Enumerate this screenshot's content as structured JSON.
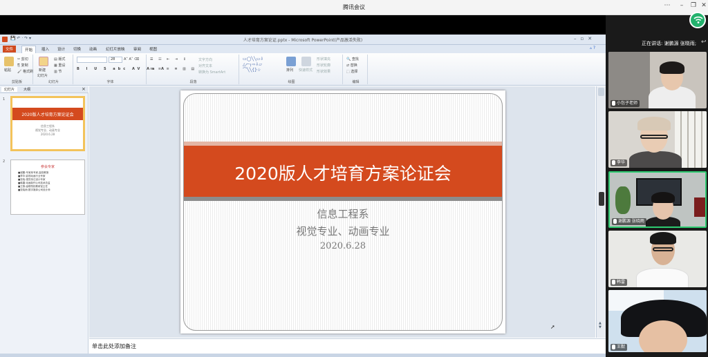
{
  "meeting": {
    "title": "腾讯会议",
    "speaking_label": "正在讲话: 谢鹏源 张晓雨;"
  },
  "ppt": {
    "window_title": "人才培育方案论证.pptx - Microsoft PowerPoint(产品激活失败)",
    "tabs": [
      "文件",
      "开始",
      "插入",
      "设计",
      "切换",
      "动画",
      "幻灯片放映",
      "审阅",
      "视图"
    ],
    "groups": {
      "clipboard": "剪贴板",
      "slides": "幻灯片",
      "font": "字体",
      "paragraph": "段落",
      "drawing": "绘图",
      "editing": "编辑"
    },
    "clipboard": {
      "paste": "粘贴",
      "cut": "剪切",
      "copy": "复制",
      "format": "格式刷"
    },
    "slides_group": {
      "new": "新建",
      "newslide": "幻灯片",
      "layout": "版式",
      "reset": "重设",
      "section": "节"
    },
    "font": {
      "size": "28"
    },
    "paragraph": {
      "direction": "文字方向",
      "align": "对齐文本",
      "smartart": "转换为 SmartArt"
    },
    "drawing": {
      "arrange": "排列",
      "quickstyles": "快速样式",
      "fill": "形状填充",
      "outline": "形状轮廓",
      "effects": "形状效果"
    },
    "editing": {
      "find": "查找",
      "replace": "替换",
      "select": "选择"
    },
    "panel_tabs": [
      "幻灯片",
      "大纲"
    ],
    "thumb1": {
      "num": "1",
      "title": "2020版人才培育方案论证会",
      "l1": "信息工程系",
      "l2": "视觉专业、动画专业",
      "l3": "2020.6.28"
    },
    "thumb2": {
      "num": "2",
      "title": "参会专家",
      "items": [
        "■谢鹏:专家库专家,高校教授",
        "■李华:影视动画行业专家",
        "■张晓:视觉传达设计专家",
        "■韩雷:动画制作公司技术总监",
        "■王默:高职院校教研室主任",
        "■张晓雨:数字媒体公司设计师"
      ]
    },
    "slide": {
      "title": "2020版人才培育方案论证会",
      "line1": "信息工程系",
      "line2": "视觉专业、动画专业",
      "line3": "2020.6.28"
    },
    "notes_placeholder": "单击此处添加备注"
  },
  "participants": [
    {
      "name": "小包子老师",
      "bg": "#c9c4bd"
    },
    {
      "name": "李华",
      "bg": "#d9d6d0"
    },
    {
      "name": "谢鹏源 张晓雨",
      "bg": "#bfc4c2"
    },
    {
      "name": "韩雷",
      "bg": "#e9e9e6"
    },
    {
      "name": "王默",
      "bg": "#cfe0ee"
    }
  ]
}
